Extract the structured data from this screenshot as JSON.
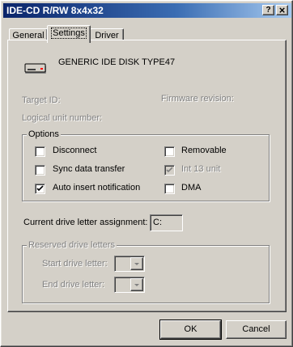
{
  "window": {
    "title": "IDE-CD R/RW 8x4x32",
    "help_label": "?",
    "close_label": "×"
  },
  "tabs": [
    {
      "label": "General"
    },
    {
      "label": "Settings"
    },
    {
      "label": "Driver"
    }
  ],
  "device": {
    "name": "GENERIC IDE  DISK TYPE47"
  },
  "labels": {
    "target_id": "Target ID:",
    "firmware_revision": "Firmware revision:",
    "logical_unit_number": "Logical unit number:"
  },
  "options": {
    "group_label": "Options",
    "disconnect": {
      "label": "Disconnect",
      "checked": false
    },
    "sync_data_transfer": {
      "label": "Sync data transfer",
      "checked": false
    },
    "auto_insert_notification": {
      "label": "Auto insert notification",
      "checked": true
    },
    "removable": {
      "label": "Removable",
      "checked": false
    },
    "int13_unit": {
      "label": "Int 13 unit",
      "checked": true,
      "disabled": true
    },
    "dma": {
      "label": "DMA",
      "checked": false
    }
  },
  "drive_letter": {
    "label": "Current drive letter assignment:",
    "value": "C:"
  },
  "reserved": {
    "group_label": "Reserved drive letters",
    "start_label": "Start drive letter:",
    "end_label": "End drive letter:"
  },
  "buttons": {
    "ok": "OK",
    "cancel": "Cancel"
  }
}
